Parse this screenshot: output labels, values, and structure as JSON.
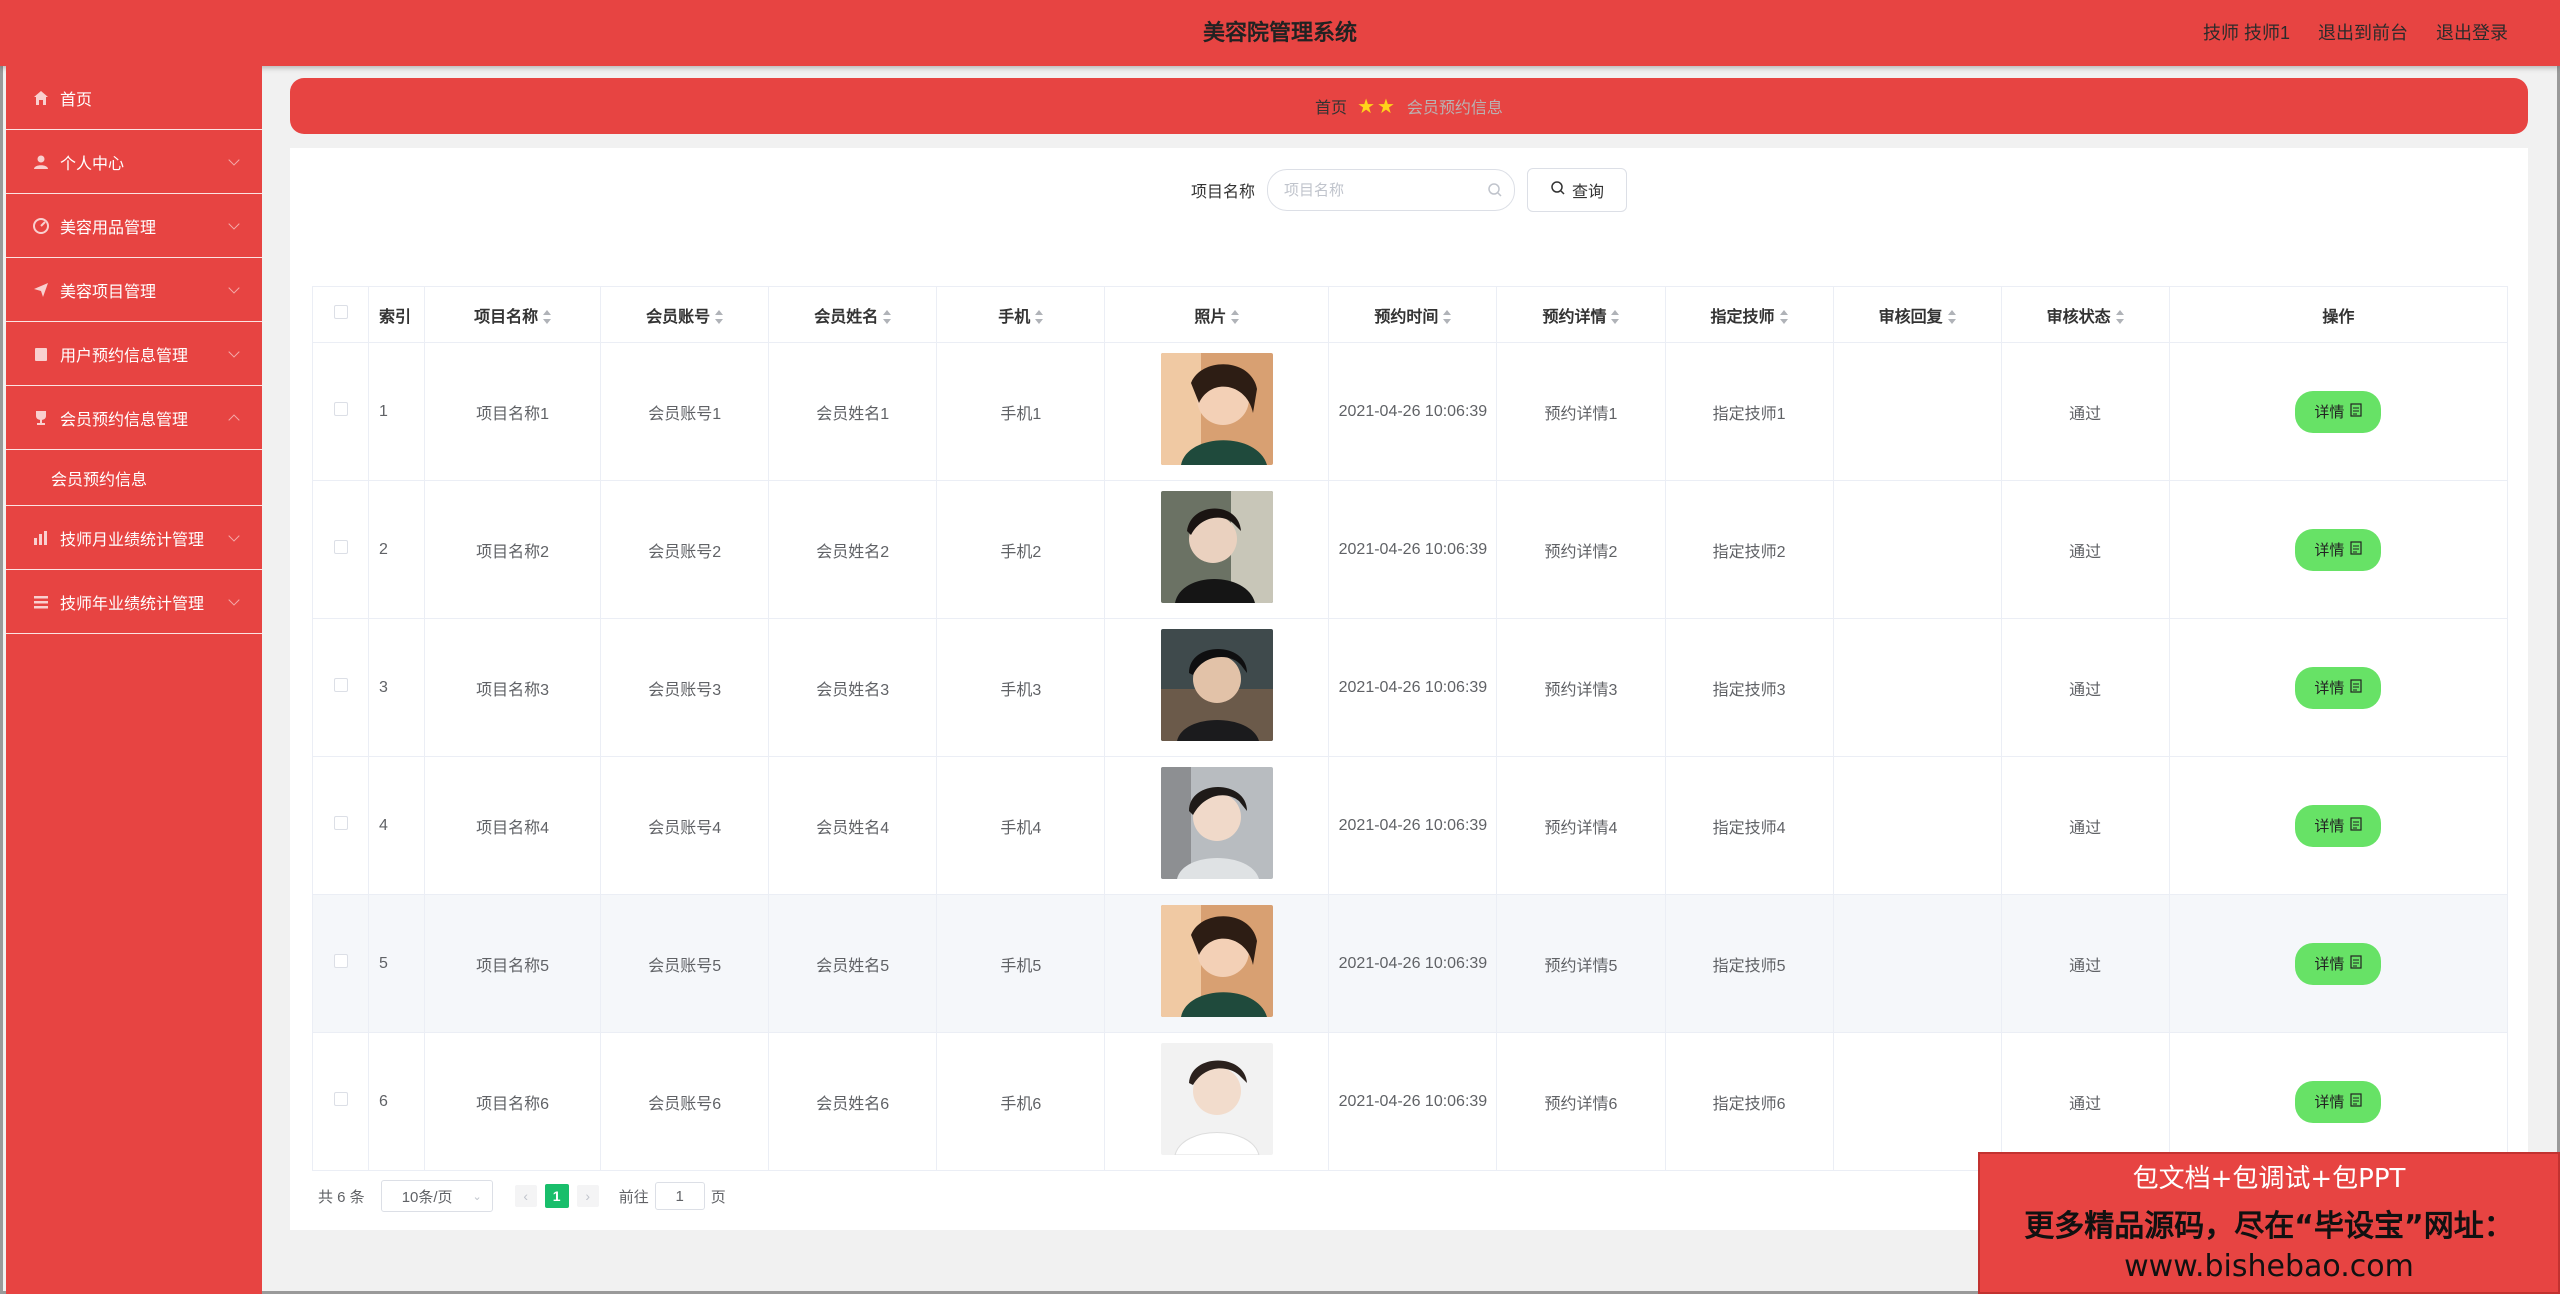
{
  "header": {
    "title": "美容院管理系统",
    "links": [
      "技师 技师1",
      "退出到前台",
      "退出登录"
    ]
  },
  "sidebar": {
    "items": [
      {
        "label": "首页",
        "icon": "home-icon"
      },
      {
        "label": "个人中心",
        "icon": "user-icon"
      },
      {
        "label": "美容用品管理",
        "icon": "dashboard-icon"
      },
      {
        "label": "美容项目管理",
        "icon": "send-icon"
      },
      {
        "label": "用户预约信息管理",
        "icon": "clipboard-icon"
      },
      {
        "label": "会员预约信息管理",
        "icon": "trophy-icon",
        "expanded": true
      },
      {
        "label": "技师月业绩统计管理",
        "icon": "bar-chart-icon"
      },
      {
        "label": "技师年业绩统计管理",
        "icon": "list-icon"
      }
    ],
    "submenu": {
      "label": "会员预约信息"
    }
  },
  "breadcrumb": {
    "home": "首页",
    "stars": "★★",
    "current": "会员预约信息"
  },
  "search": {
    "label": "项目名称",
    "placeholder": "项目名称",
    "button_label": "查询"
  },
  "table": {
    "headers": [
      "索引",
      "项目名称",
      "会员账号",
      "会员姓名",
      "手机",
      "照片",
      "预约时间",
      "预约详情",
      "指定技师",
      "审核回复",
      "审核状态",
      "操作"
    ],
    "detail_label": "详情",
    "rows": [
      {
        "index": "1",
        "project": "项目名称1",
        "account": "会员账号1",
        "name": "会员姓名1",
        "phone": "手机1",
        "time": "2021-04-26 10:06:39",
        "detail": "预约详情1",
        "tech": "指定技师1",
        "reply": "",
        "status": "通过"
      },
      {
        "index": "2",
        "project": "项目名称2",
        "account": "会员账号2",
        "name": "会员姓名2",
        "phone": "手机2",
        "time": "2021-04-26 10:06:39",
        "detail": "预约详情2",
        "tech": "指定技师2",
        "reply": "",
        "status": "通过"
      },
      {
        "index": "3",
        "project": "项目名称3",
        "account": "会员账号3",
        "name": "会员姓名3",
        "phone": "手机3",
        "time": "2021-04-26 10:06:39",
        "detail": "预约详情3",
        "tech": "指定技师3",
        "reply": "",
        "status": "通过"
      },
      {
        "index": "4",
        "project": "项目名称4",
        "account": "会员账号4",
        "name": "会员姓名4",
        "phone": "手机4",
        "time": "2021-04-26 10:06:39",
        "detail": "预约详情4",
        "tech": "指定技师4",
        "reply": "",
        "status": "通过"
      },
      {
        "index": "5",
        "project": "项目名称5",
        "account": "会员账号5",
        "name": "会员姓名5",
        "phone": "手机5",
        "time": "2021-04-26 10:06:39",
        "detail": "预约详情5",
        "tech": "指定技师5",
        "reply": "",
        "status": "通过"
      },
      {
        "index": "6",
        "project": "项目名称6",
        "account": "会员账号6",
        "name": "会员姓名6",
        "phone": "手机6",
        "time": "2021-04-26 10:06:39",
        "detail": "预约详情6",
        "tech": "指定技师6",
        "reply": "",
        "status": "通过"
      }
    ]
  },
  "pagination": {
    "total": "共 6 条",
    "page_size": "10条/页",
    "current_page": "1",
    "goto_prefix": "前往",
    "goto_value": "1",
    "goto_suffix": "页"
  },
  "ad": {
    "line1": "包文档+包调试+包PPT",
    "line2": "更多精品源码，尽在“毕设宝”网址：",
    "line3": "www.bishebao.com"
  },
  "colors": {
    "primary": "#e74442",
    "detail_button": "#67e266",
    "active_page": "#19be6b",
    "breadcrumb_stars": "#ffd31a"
  }
}
